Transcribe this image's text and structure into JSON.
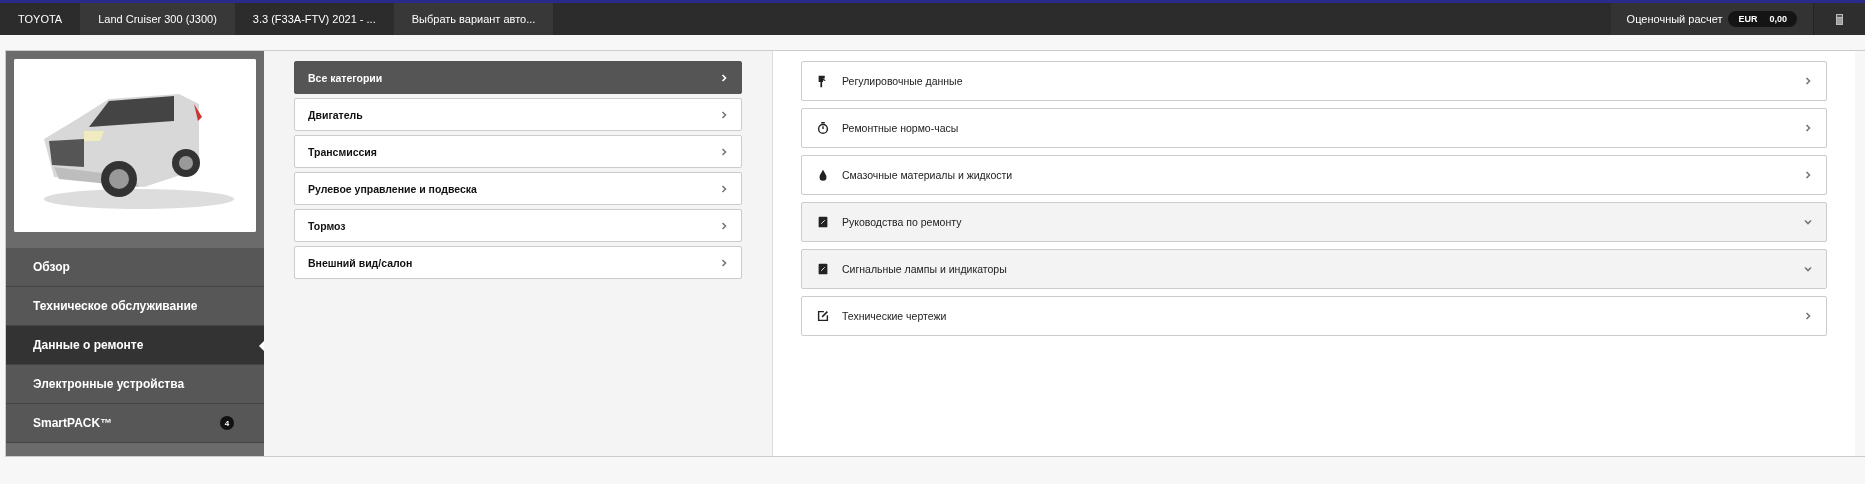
{
  "breadcrumbs": [
    {
      "label": "TOYOTA",
      "selected": false
    },
    {
      "label": "Land Cruiser 300 (J300)",
      "selected": true
    },
    {
      "label": "3.3 (F33A-FTV) 2021 - ...",
      "selected": false
    },
    {
      "label": "Выбрать вариант авто...",
      "selected": true
    }
  ],
  "estimate": {
    "label": "Оценочный расчет",
    "currency": "EUR",
    "amount": "0,00"
  },
  "sidebar": {
    "items": [
      {
        "label": "Обзор",
        "selected": false
      },
      {
        "label": "Техническое обслуживание",
        "selected": false
      },
      {
        "label": "Данные о ремонте",
        "selected": true
      },
      {
        "label": "Электронные устройства",
        "selected": false
      },
      {
        "label": "SmartPACK™",
        "selected": false,
        "badge": "4"
      }
    ]
  },
  "categories": [
    {
      "label": "Все категории",
      "selected": true
    },
    {
      "label": "Двигатель",
      "selected": false
    },
    {
      "label": "Трансмиссия",
      "selected": false
    },
    {
      "label": "Рулевое управление и подвеска",
      "selected": false
    },
    {
      "label": "Тормоз",
      "selected": false
    },
    {
      "label": "Внешний вид/салон",
      "selected": false
    }
  ],
  "sections": [
    {
      "label": "Регулировочные данные",
      "kind": "link"
    },
    {
      "label": "Ремонтные нормо-часы",
      "kind": "link"
    },
    {
      "label": "Смазочные материалы и жидкости",
      "kind": "link"
    },
    {
      "label": "Руководства по ремонту",
      "kind": "expand"
    },
    {
      "label": "Сигнальные лампы и индикаторы",
      "kind": "expand"
    },
    {
      "label": "Технические чертежи",
      "kind": "link"
    }
  ]
}
